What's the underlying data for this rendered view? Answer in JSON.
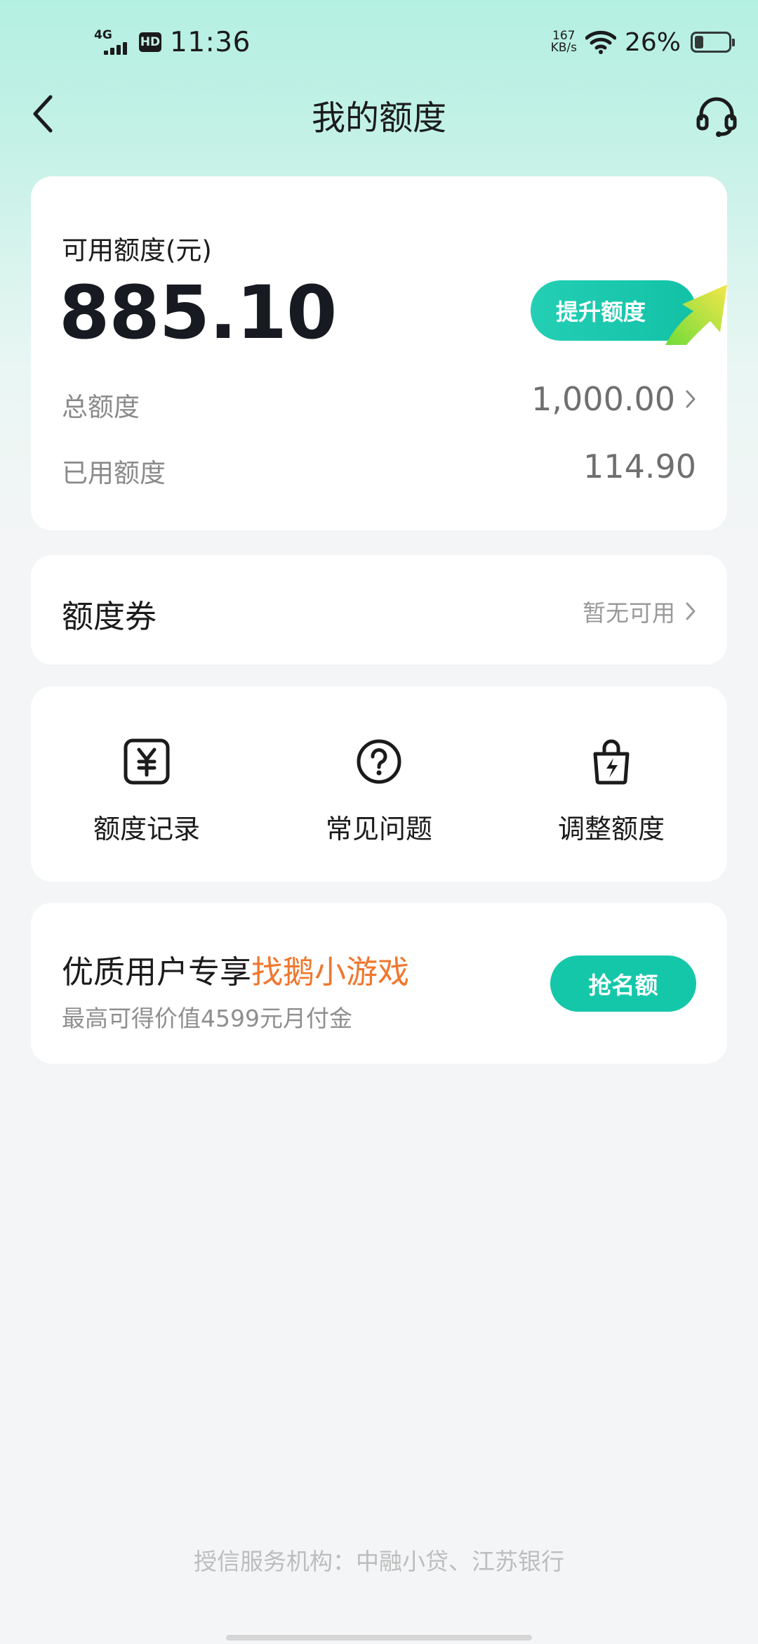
{
  "status_bar": {
    "network": "4G",
    "hd": "HD",
    "time": "11:36",
    "speed_value": "167",
    "speed_unit": "KB/s",
    "battery_pct": "26%",
    "battery_level": 0.26
  },
  "nav": {
    "title": "我的额度",
    "back_icon": "chevron-left-icon",
    "service_icon": "headset-icon"
  },
  "quota": {
    "available_label": "可用额度(元)",
    "available_value": "885.10",
    "raise_button": "提升额度",
    "total_label": "总额度",
    "total_value": "1,000.00",
    "used_label": "已用额度",
    "used_value": "114.90"
  },
  "coupon": {
    "title": "额度券",
    "status": "暂无可用"
  },
  "shortcuts": [
    {
      "label": "额度记录",
      "icon": "yuan-record-icon"
    },
    {
      "label": "常见问题",
      "icon": "question-circle-icon"
    },
    {
      "label": "调整额度",
      "icon": "lightning-bag-icon"
    }
  ],
  "promo": {
    "title_prefix": "优质用户专享",
    "title_highlight": "找鹅小游戏",
    "subtitle": "最高可得价值4599元月付金",
    "button": "抢名额"
  },
  "footer": {
    "note": "授信服务机构：中融小贷、江苏银行"
  },
  "colors": {
    "accent": "#15c7a9",
    "highlight": "#f0772e",
    "header_bg": "#b4f0e2"
  }
}
